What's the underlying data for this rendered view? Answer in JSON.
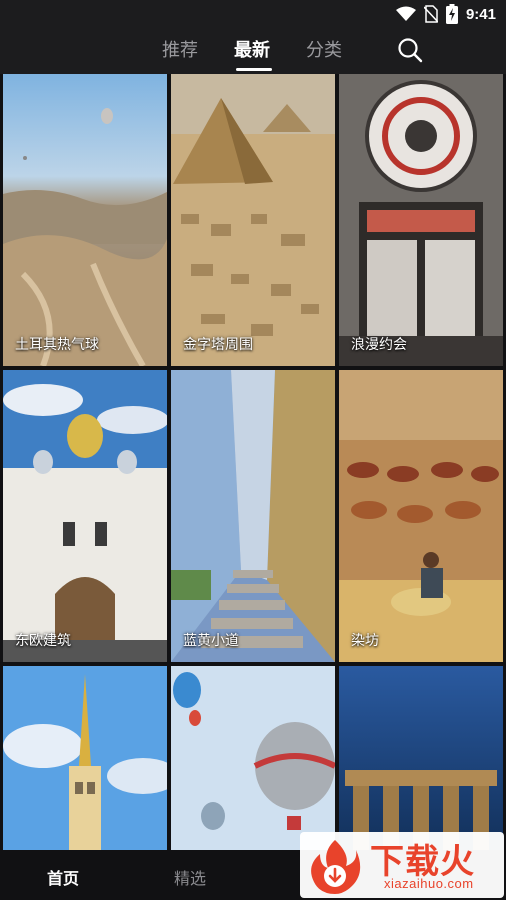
{
  "status_bar": {
    "time": "9:41"
  },
  "tabs": [
    {
      "label": "推荐"
    },
    {
      "label": "最新"
    },
    {
      "label": "分类"
    }
  ],
  "active_tab": "最新",
  "tiles": [
    {
      "label": "土耳其热气球"
    },
    {
      "label": "金字塔周围"
    },
    {
      "label": "浪漫约会"
    },
    {
      "label": "东欧建筑"
    },
    {
      "label": "蓝黄小道"
    },
    {
      "label": "染坊"
    },
    {
      "label": ""
    },
    {
      "label": ""
    },
    {
      "label": ""
    }
  ],
  "bottom_nav": [
    {
      "label": "首页"
    },
    {
      "label": "精选"
    }
  ],
  "watermark": {
    "title": "下载火",
    "url": "xiazaihuo.com"
  }
}
